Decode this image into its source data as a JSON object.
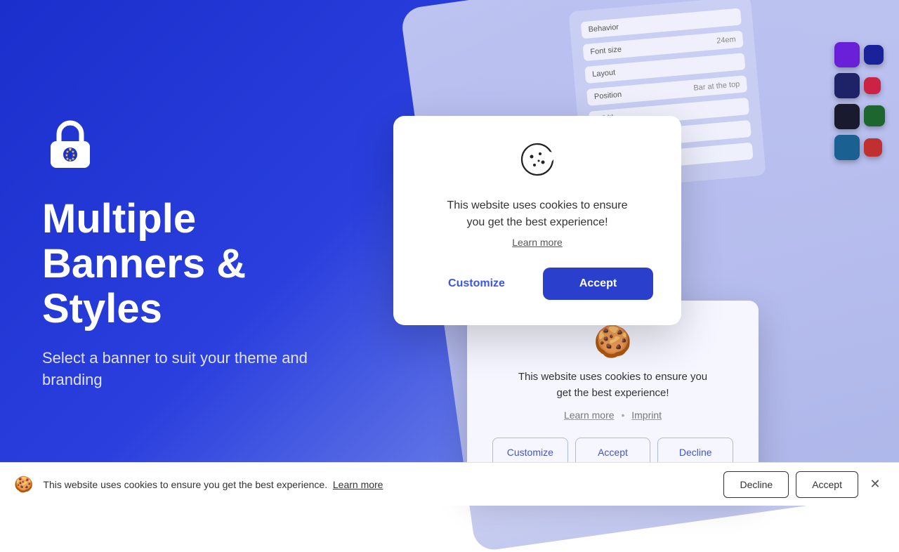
{
  "background": {
    "color_start": "#1a2fcc",
    "color_end": "#6b7fe8"
  },
  "left_section": {
    "headline": "Multiple\nBanners &\nStyles",
    "headline_line1": "Multiple",
    "headline_line2": "Banners &",
    "headline_line3": "Styles",
    "subheadline": "Select a banner to suit your theme and branding"
  },
  "banner1": {
    "cookie_icon": "🍪",
    "text_line1": "This website uses cookies to ensure",
    "text_line2": "you get the best experience!",
    "learn_more_label": "Learn more",
    "customize_label": "Customize",
    "accept_label": "Accept"
  },
  "banner2": {
    "cookie_icon": "🍪",
    "text_line1": "This website uses cookies to ensure you",
    "text_line2": "get the best experience!",
    "learn_more_label": "Learn more",
    "imprint_label": "Imprint",
    "dot": "•",
    "customize_label": "Customize",
    "accept_label": "Accept",
    "decline_label": "Decline"
  },
  "bottom_bar": {
    "text": "This website uses cookies to ensure you get the best experience.",
    "learn_more_label": "Learn more",
    "decline_label": "Decline",
    "accept_label": "Accept"
  },
  "swatches": [
    {
      "color": "#6a1fd8"
    },
    {
      "color": "#1a2299"
    },
    {
      "color": "#c02020"
    },
    {
      "color": "#2a2a2a"
    },
    {
      "color": "#2a5fa8"
    },
    {
      "color": "#1e6630"
    },
    {
      "color": "#c03030"
    },
    {
      "color": "#1a6090"
    }
  ]
}
